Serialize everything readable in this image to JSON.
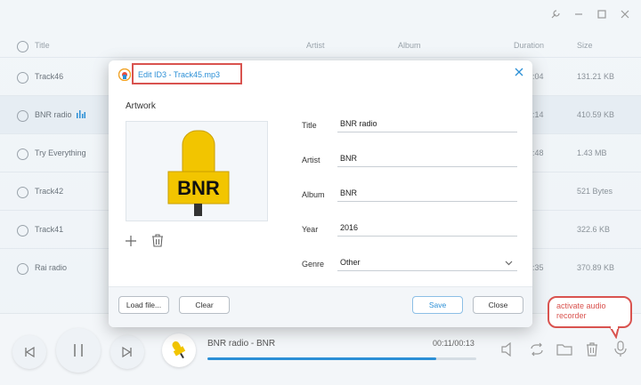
{
  "columns": {
    "title": "Title",
    "artist": "Artist",
    "album": "Album",
    "duration": "Duration",
    "size": "Size"
  },
  "rows": [
    {
      "title": "Track46",
      "duration": ":04",
      "size": "131.21 KB"
    },
    {
      "title": "BNR radio",
      "duration": ":14",
      "size": "410.59 KB"
    },
    {
      "title": "Try Everything",
      "duration": ":48",
      "size": "1.43 MB"
    },
    {
      "title": "Track42",
      "duration": "",
      "size": "521 Bytes"
    },
    {
      "title": "Track41",
      "duration": "",
      "size": "322.6 KB"
    },
    {
      "title": "Rai radio",
      "duration": ":35",
      "size": "370.89 KB"
    }
  ],
  "dialog": {
    "title": "Edit ID3 - Track45.mp3",
    "artwork_label": "Artwork",
    "artwork_text": "BNR",
    "fields": {
      "title_label": "Title",
      "title": "BNR radio",
      "artist_label": "Artist",
      "artist": "BNR",
      "album_label": "Album",
      "album": "BNR",
      "year_label": "Year",
      "year": "2016",
      "genre_label": "Genre",
      "genre": "Other"
    },
    "buttons": {
      "load": "Load file...",
      "clear": "Clear",
      "save": "Save",
      "close": "Close"
    }
  },
  "player": {
    "now_playing": "BNR radio - BNR",
    "time": "00:11/00:13",
    "progress": 0.85
  },
  "callout": "activate audio recorder",
  "colors": {
    "accent": "#2b8fd6",
    "highlight": "#d9534f"
  }
}
